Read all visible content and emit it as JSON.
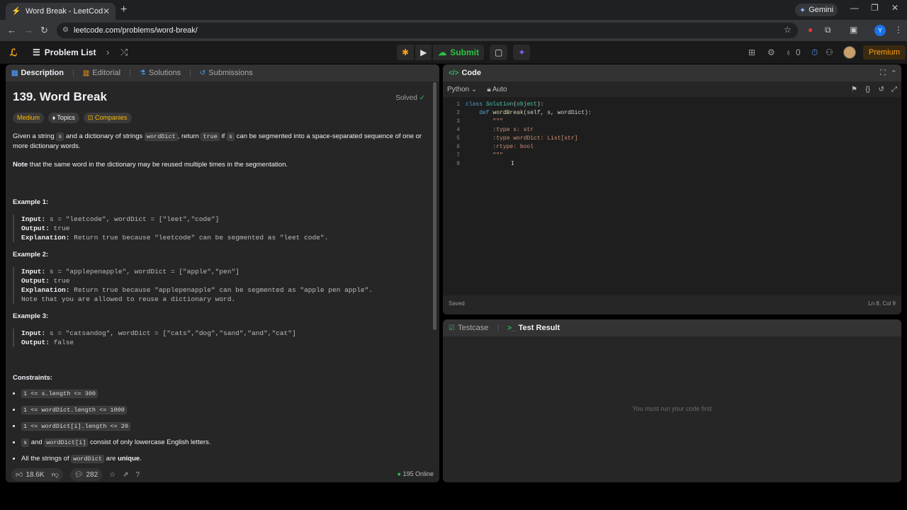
{
  "browser": {
    "tab_title": "Word Break - LeetCode",
    "url": "leetcode.com/problems/word-break/",
    "gemini_label": "Gemini",
    "profile_initial": "Y"
  },
  "nav": {
    "problem_list": "Problem List",
    "submit": "Submit",
    "streak": "0",
    "premium": "Premium"
  },
  "desc_tabs": [
    "Description",
    "Editorial",
    "Solutions",
    "Submissions"
  ],
  "problem": {
    "title": "139. Word Break",
    "solved": "Solved",
    "difficulty": "Medium",
    "topics": "Topics",
    "companies": "Companies",
    "p1_a": "Given a string ",
    "p1_s": "s",
    "p1_b": " and a dictionary of strings ",
    "p1_wd": "wordDict",
    "p1_c": ", return ",
    "p1_true": "true",
    "p1_d": " if ",
    "p1_s2": "s",
    "p1_e": " can be segmented into a space-separated sequence of one or more dictionary words.",
    "note_bold": "Note",
    "note_text": " that the same word in the dictionary may be reused multiple times in the segmentation.",
    "examples": [
      {
        "heading": "Example 1:",
        "input": "s = \"leetcode\", wordDict = [\"leet\",\"code\"]",
        "output": "true",
        "explanation": "Return true because \"leetcode\" can be segmented as \"leet code\".",
        "extra": ""
      },
      {
        "heading": "Example 2:",
        "input": "s = \"applepenapple\", wordDict = [\"apple\",\"pen\"]",
        "output": "true",
        "explanation": "Return true because \"applepenapple\" can be segmented as \"apple pen apple\".",
        "extra": "Note that you are allowed to reuse a dictionary word."
      },
      {
        "heading": "Example 3:",
        "input": "s = \"catsandog\", wordDict = [\"cats\",\"dog\",\"sand\",\"and\",\"cat\"]",
        "output": "false",
        "explanation": "",
        "extra": ""
      }
    ],
    "labels": {
      "input": "Input:",
      "output": "Output:",
      "explanation": "Explanation:"
    },
    "constraints_heading": "Constraints:",
    "constraints": {
      "c1": "1 <= s.length <= 300",
      "c2": "1 <= wordDict.length <= 1000",
      "c3": "1 <= wordDict[i].length <= 20",
      "c4_s": "s",
      "c4_and": " and ",
      "c4_wd": "wordDict[i]",
      "c4_rest": " consist of only lowercase English letters.",
      "c5_a": "All the strings of ",
      "c5_wd": "wordDict",
      "c5_b": " are ",
      "c5_unique": "unique",
      "c5_end": "."
    }
  },
  "footer": {
    "likes": "18.6K",
    "comments": "282",
    "online": "195 Online"
  },
  "code_panel": {
    "title": "Code",
    "language": "Python",
    "mode": "Auto",
    "status_left": "Saved",
    "status_right": "Ln 8, Col 9",
    "lines": [
      {
        "n": "1",
        "text": "class Solution(object):"
      },
      {
        "n": "2",
        "text": "    def wordBreak(self, s, wordDict):"
      },
      {
        "n": "3",
        "text": "        \"\"\""
      },
      {
        "n": "4",
        "text": "        :type s: str"
      },
      {
        "n": "5",
        "text": "        :type wordDict: List[str]"
      },
      {
        "n": "6",
        "text": "        :rtype: bool"
      },
      {
        "n": "7",
        "text": "        \"\"\""
      },
      {
        "n": "8",
        "text": ""
      }
    ]
  },
  "test_panel": {
    "testcase": "Testcase",
    "test_result": "Test Result",
    "empty_message": "You must run your code first"
  }
}
